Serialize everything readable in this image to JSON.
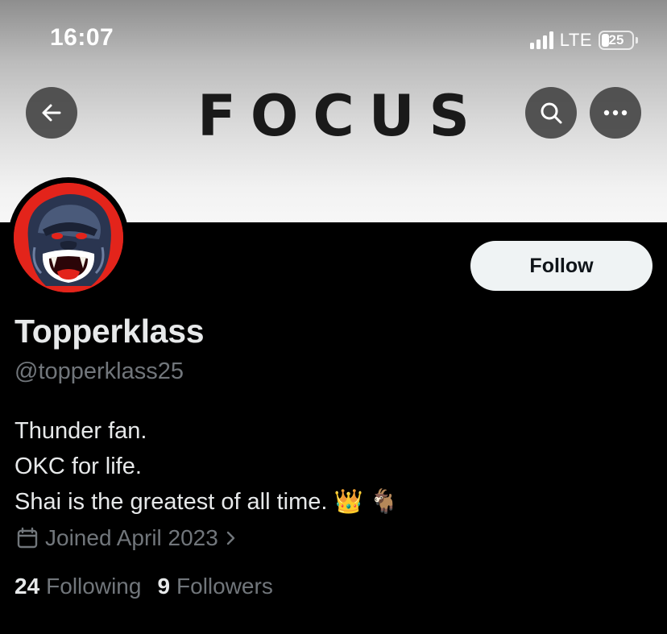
{
  "status_bar": {
    "time": "16:07",
    "network": "LTE",
    "battery_percent": "25",
    "battery_level": 0.25
  },
  "header": {
    "banner_text": "FOCUS",
    "back_icon": "back-arrow-icon",
    "search_icon": "search-icon",
    "more_icon": "more-icon"
  },
  "profile": {
    "display_name": "Topperklass",
    "handle": "@topperklass25",
    "follow_label": "Follow",
    "bio_lines": [
      "Thunder fan.",
      "OKC for life.",
      "Shai is the greatest of all time. 👑 🐐"
    ],
    "joined": "Joined April 2023",
    "following_count": "24",
    "following_label": "Following",
    "followers_count": "9",
    "followers_label": "Followers"
  },
  "colors": {
    "background": "#000000",
    "primary_text": "#e7e9ea",
    "secondary_text": "#71767b",
    "follow_bg": "#eff3f4",
    "avatar_bg": "#e3241b"
  }
}
